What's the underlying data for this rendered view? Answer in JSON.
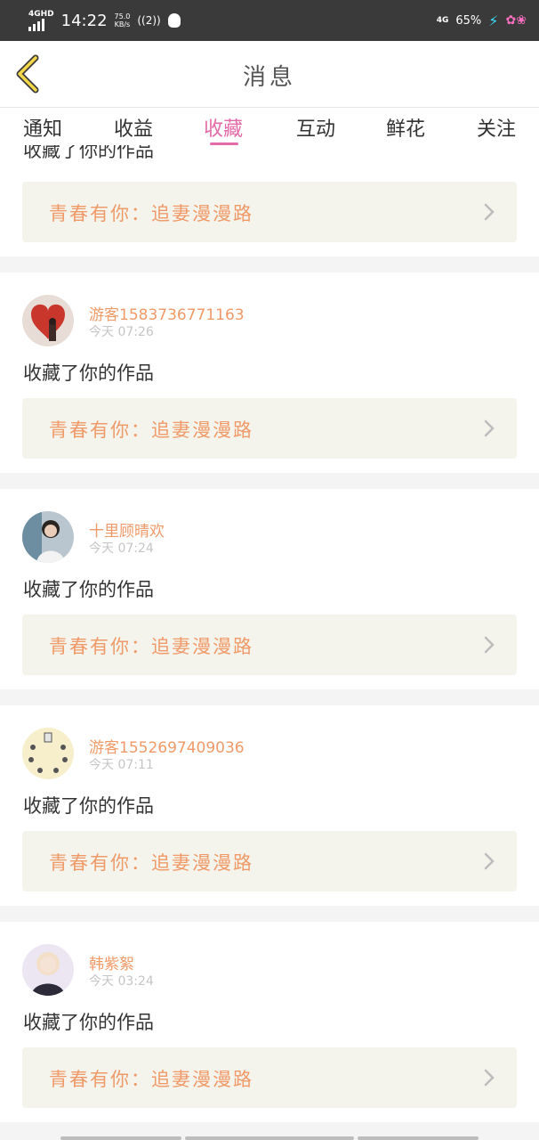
{
  "status": {
    "network": "4GHD",
    "time": "14:22",
    "speed_value": "75.0",
    "speed_unit": "KB/s",
    "hotspot": "((2))",
    "net_right": "4G",
    "battery": "65%"
  },
  "header": {
    "title": "消息"
  },
  "tabs": [
    {
      "label": "通知"
    },
    {
      "label": "收益"
    },
    {
      "label": "收藏"
    },
    {
      "label": "互动"
    },
    {
      "label": "鲜花"
    },
    {
      "label": "关注"
    }
  ],
  "active_tab": "收藏",
  "items": [
    {
      "action": "收藏了你的作品",
      "work": "青春有你：追妻漫漫路"
    },
    {
      "user": "游客1583736771163",
      "time": "今天 07:26",
      "action": "收藏了你的作品",
      "work": "青春有你：追妻漫漫路"
    },
    {
      "user": "十里顾晴欢",
      "time": "今天 07:24",
      "action": "收藏了你的作品",
      "work": "青春有你：追妻漫漫路"
    },
    {
      "user": "游客1552697409036",
      "time": "今天 07:11",
      "action": "收藏了你的作品",
      "work": "青春有你：追妻漫漫路"
    },
    {
      "user": "韩紫絮",
      "time": "今天 03:24",
      "action": "收藏了你的作品",
      "work": "青春有你：追妻漫漫路"
    }
  ],
  "colors": {
    "accent": "#e56aa8",
    "username": "#ef9a68",
    "work_bg": "#f4f4ec",
    "back_arrow": "#f2d84a"
  }
}
